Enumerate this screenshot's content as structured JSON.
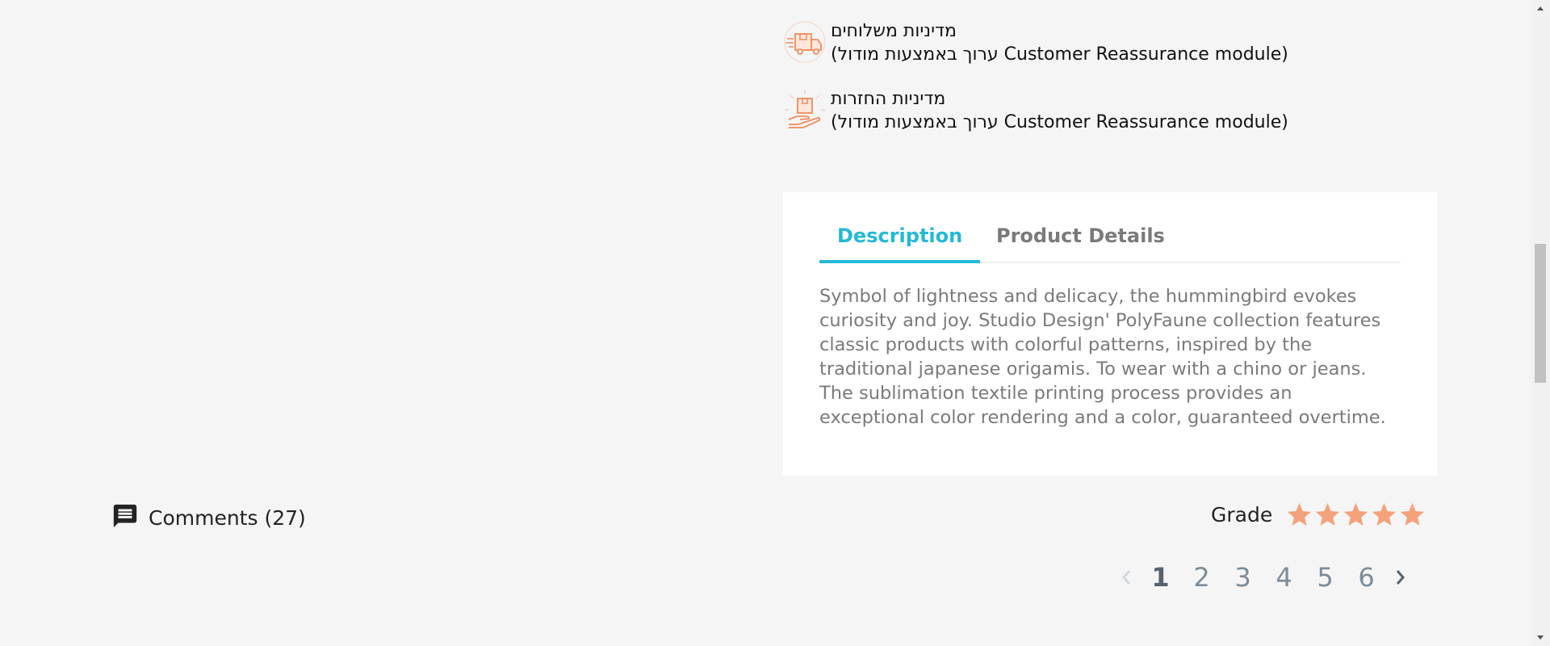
{
  "reassurance": {
    "items": [
      {
        "icon": "delivery-truck-icon",
        "title": "מדיניות משלוחים",
        "body": "(ערוך באמצעות מודול Customer Reassurance module)"
      },
      {
        "icon": "returns-box-hand-icon",
        "title": "מדיניות החזרות",
        "body": "(ערוך באמצעות מודול Customer Reassurance module)"
      }
    ],
    "icon_color": "#f08c5a"
  },
  "tabs": {
    "items": [
      {
        "label": "Description",
        "active": true
      },
      {
        "label": "Product Details",
        "active": false
      }
    ],
    "accent_color": "#24b9d7",
    "description": "Symbol of lightness and delicacy, the hummingbird evokes curiosity and joy. Studio Design' PolyFaune collection features classic products with colorful patterns, inspired by the traditional japanese origamis. To wear with a chino or jeans. The sublimation textile printing process provides an exceptional color rendering and a color, guaranteed overtime."
  },
  "comments": {
    "icon": "comment-icon",
    "label": "Comments (27)"
  },
  "grade": {
    "label": "Grade",
    "rating": 5,
    "max": 5,
    "star_color": "#f4a27c"
  },
  "pagination": {
    "pages": [
      "1",
      "2",
      "3",
      "4",
      "5",
      "6"
    ],
    "current": "1",
    "prev_icon": "chevron-left-icon",
    "next_icon": "chevron-right-icon"
  }
}
